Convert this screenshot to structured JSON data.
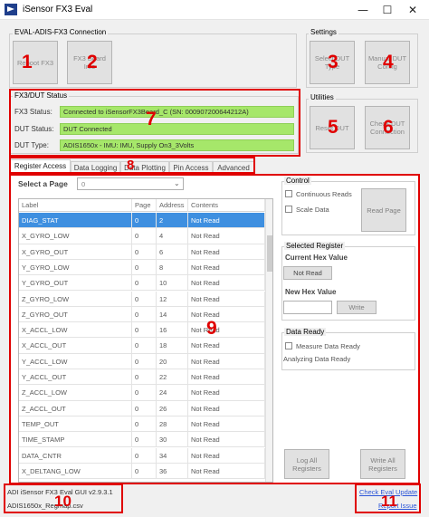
{
  "window": {
    "title": "iSensor FX3 Eval",
    "controls": {
      "minimize": "—",
      "maximize": "☐",
      "close": "✕"
    }
  },
  "connection_group": {
    "title": "EVAL-ADIS-FX3 Connection",
    "reboot_label": "Reboot FX3",
    "fx3_board_label": "FX3 Board Info"
  },
  "settings_group": {
    "title": "Settings",
    "select_dut_label": "Select DUT Type",
    "manual_dut_label": "Manual DUT Config"
  },
  "utilities_group": {
    "title": "Utilities",
    "reset_dut_label": "Reset DUT",
    "check_dut_label": "Check DUT Connection"
  },
  "status_group": {
    "title": "FX3/DUT Status",
    "fx3_status_label": "FX3 Status:",
    "fx3_status_value": "Connected to iSensorFX3Board_C (SN: 000907200644212A)",
    "dut_status_label": "DUT Status:",
    "dut_status_value": "DUT Connected",
    "dut_type_label": "DUT Type:",
    "dut_type_value": "ADIS1650x - IMU: IMU, Supply On3_3Volts"
  },
  "tabs": [
    "Register Access",
    "Data Logging",
    "Data Plotting",
    "Pin Access",
    "Advanced"
  ],
  "register_access": {
    "select_page_label": "Select a Page",
    "page_value": "0",
    "columns": [
      "Label",
      "Page",
      "Address",
      "Contents"
    ],
    "rows": [
      [
        "DIAG_STAT",
        "0",
        "2",
        "Not Read"
      ],
      [
        "X_GYRO_LOW",
        "0",
        "4",
        "Not Read"
      ],
      [
        "X_GYRO_OUT",
        "0",
        "6",
        "Not Read"
      ],
      [
        "Y_GYRO_LOW",
        "0",
        "8",
        "Not Read"
      ],
      [
        "Y_GYRO_OUT",
        "0",
        "10",
        "Not Read"
      ],
      [
        "Z_GYRO_LOW",
        "0",
        "12",
        "Not Read"
      ],
      [
        "Z_GYRO_OUT",
        "0",
        "14",
        "Not Read"
      ],
      [
        "X_ACCL_LOW",
        "0",
        "16",
        "Not Read"
      ],
      [
        "X_ACCL_OUT",
        "0",
        "18",
        "Not Read"
      ],
      [
        "Y_ACCL_LOW",
        "0",
        "20",
        "Not Read"
      ],
      [
        "Y_ACCL_OUT",
        "0",
        "22",
        "Not Read"
      ],
      [
        "Z_ACCL_LOW",
        "0",
        "24",
        "Not Read"
      ],
      [
        "Z_ACCL_OUT",
        "0",
        "26",
        "Not Read"
      ],
      [
        "TEMP_OUT",
        "0",
        "28",
        "Not Read"
      ],
      [
        "TIME_STAMP",
        "0",
        "30",
        "Not Read"
      ],
      [
        "DATA_CNTR",
        "0",
        "34",
        "Not Read"
      ],
      [
        "X_DELTANG_LOW",
        "0",
        "36",
        "Not Read"
      ]
    ],
    "control_title": "Control",
    "continuous_reads": "Continuous Reads",
    "scale_data": "Scale Data",
    "read_page": "Read Page",
    "selected_register_title": "Selected Register",
    "current_hex_label": "Current Hex Value",
    "current_hex_value": "Not Read",
    "new_hex_label": "New Hex Value",
    "new_hex_value": "",
    "write_label": "Write",
    "data_ready_title": "Data Ready",
    "measure_data_ready": "Measure Data Ready",
    "analyzing_data_ready": "Analyzing Data Ready",
    "log_all_label": "Log All Registers",
    "write_all_label": "Write All Registers"
  },
  "footer": {
    "version": "ADI iSensor FX3 Eval GUI v2.9.3.1",
    "regmap": "ADIS1650x_Regmap.csv",
    "check_update": "Check Eval Update",
    "report_issue": "Report Issue"
  },
  "annotations": [
    "1",
    "2",
    "3",
    "4",
    "5",
    "6",
    "7",
    "8",
    "9",
    "10",
    "11"
  ],
  "colors": {
    "annotation_red": "#e00000",
    "status_green": "#a6e76a",
    "selection_blue": "#3e8fe0",
    "link_blue": "#2b55d8"
  }
}
